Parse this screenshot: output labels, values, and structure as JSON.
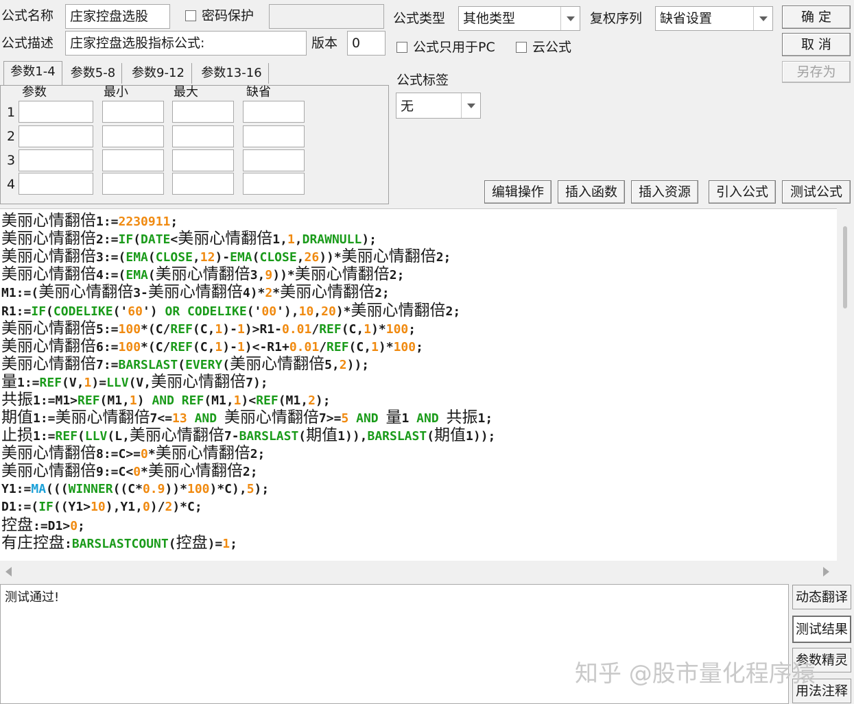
{
  "header": {
    "formula_name_label": "公式名称",
    "formula_name_value": "庄家控盘选股",
    "password_label": "密码保护",
    "password_value": "",
    "formula_desc_label": "公式描述",
    "formula_desc_value": "庄家控盘选股指标公式:",
    "version_label": "版本",
    "version_value": "0",
    "formula_type_label": "公式类型",
    "formula_type_value": "其他类型",
    "fuquan_label": "复权序列",
    "fuquan_value": "缺省设置",
    "pc_only_label": "公式只用于PC",
    "cloud_label": "云公式",
    "tag_label": "公式标签",
    "tag_value": "无"
  },
  "buttons": {
    "ok": "确  定",
    "cancel": "取  消",
    "save_as": "另存为",
    "edit_ops": "编辑操作",
    "insert_func": "插入函数",
    "insert_res": "插入资源",
    "import_formula": "引入公式",
    "test_formula": "测试公式"
  },
  "params": {
    "tabs": [
      "参数1-4",
      "参数5-8",
      "参数9-12",
      "参数13-16"
    ],
    "columns": [
      "参数",
      "最小",
      "最大",
      "缺省"
    ],
    "rows": [
      "1",
      "2",
      "3",
      "4"
    ]
  },
  "code_lines": [
    [
      [
        "cj",
        "美丽心情翻倍"
      ],
      [
        "v",
        "1:="
      ],
      [
        "n",
        "2230911"
      ],
      [
        "v",
        ";"
      ]
    ],
    [
      [
        "cj",
        "美丽心情翻倍"
      ],
      [
        "v",
        "2:="
      ],
      [
        "f",
        "IF"
      ],
      [
        "v",
        "("
      ],
      [
        "f",
        "DATE"
      ],
      [
        "v",
        "<"
      ],
      [
        "cj",
        "美丽心情翻倍"
      ],
      [
        "v",
        "1,"
      ],
      [
        "n",
        "1"
      ],
      [
        "v",
        ","
      ],
      [
        "f",
        "DRAWNULL"
      ],
      [
        "v",
        ");"
      ]
    ],
    [
      [
        "cj",
        "美丽心情翻倍"
      ],
      [
        "v",
        "3:=("
      ],
      [
        "f",
        "EMA"
      ],
      [
        "v",
        "("
      ],
      [
        "f",
        "CLOSE"
      ],
      [
        "v",
        ","
      ],
      [
        "n",
        "12"
      ],
      [
        "v",
        ")-"
      ],
      [
        "f",
        "EMA"
      ],
      [
        "v",
        "("
      ],
      [
        "f",
        "CLOSE"
      ],
      [
        "v",
        ","
      ],
      [
        "n",
        "26"
      ],
      [
        "v",
        "))*"
      ],
      [
        "cj",
        "美丽心情翻倍"
      ],
      [
        "v",
        "2;"
      ]
    ],
    [
      [
        "cj",
        "美丽心情翻倍"
      ],
      [
        "v",
        "4:=("
      ],
      [
        "f",
        "EMA"
      ],
      [
        "v",
        "("
      ],
      [
        "cj",
        "美丽心情翻倍"
      ],
      [
        "v",
        "3,"
      ],
      [
        "n",
        "9"
      ],
      [
        "v",
        "))*"
      ],
      [
        "cj",
        "美丽心情翻倍"
      ],
      [
        "v",
        "2;"
      ]
    ],
    [
      [
        "v",
        "M1:=("
      ],
      [
        "cj",
        "美丽心情翻倍"
      ],
      [
        "v",
        "3-"
      ],
      [
        "cj",
        "美丽心情翻倍"
      ],
      [
        "v",
        "4)*"
      ],
      [
        "n",
        "2"
      ],
      [
        "v",
        "*"
      ],
      [
        "cj",
        "美丽心情翻倍"
      ],
      [
        "v",
        "2;"
      ]
    ],
    [
      [
        "v",
        "R1:="
      ],
      [
        "f",
        "IF"
      ],
      [
        "v",
        "("
      ],
      [
        "f",
        "CODELIKE"
      ],
      [
        "v",
        "('"
      ],
      [
        "n",
        "60"
      ],
      [
        "v",
        "') "
      ],
      [
        "f",
        "OR"
      ],
      [
        "v",
        " "
      ],
      [
        "f",
        "CODELIKE"
      ],
      [
        "v",
        "('"
      ],
      [
        "n",
        "00"
      ],
      [
        "v",
        "'),"
      ],
      [
        "n",
        "10"
      ],
      [
        "v",
        ","
      ],
      [
        "n",
        "20"
      ],
      [
        "v",
        ")*"
      ],
      [
        "cj",
        "美丽心情翻倍"
      ],
      [
        "v",
        "2;"
      ]
    ],
    [
      [
        "cj",
        "美丽心情翻倍"
      ],
      [
        "v",
        "5:="
      ],
      [
        "n",
        "100"
      ],
      [
        "v",
        "*(C/"
      ],
      [
        "f",
        "REF"
      ],
      [
        "v",
        "(C,"
      ],
      [
        "n",
        "1"
      ],
      [
        "v",
        ")-"
      ],
      [
        "n",
        "1"
      ],
      [
        "v",
        ")>R1-"
      ],
      [
        "n",
        "0.01"
      ],
      [
        "v",
        "/"
      ],
      [
        "f",
        "REF"
      ],
      [
        "v",
        "(C,"
      ],
      [
        "n",
        "1"
      ],
      [
        "v",
        ")*"
      ],
      [
        "n",
        "100"
      ],
      [
        "v",
        ";"
      ]
    ],
    [
      [
        "cj",
        "美丽心情翻倍"
      ],
      [
        "v",
        "6:="
      ],
      [
        "n",
        "100"
      ],
      [
        "v",
        "*(C/"
      ],
      [
        "f",
        "REF"
      ],
      [
        "v",
        "(C,"
      ],
      [
        "n",
        "1"
      ],
      [
        "v",
        ")-"
      ],
      [
        "n",
        "1"
      ],
      [
        "v",
        ")<-R1+"
      ],
      [
        "n",
        "0.01"
      ],
      [
        "v",
        "/"
      ],
      [
        "f",
        "REF"
      ],
      [
        "v",
        "(C,"
      ],
      [
        "n",
        "1"
      ],
      [
        "v",
        ")*"
      ],
      [
        "n",
        "100"
      ],
      [
        "v",
        ";"
      ]
    ],
    [
      [
        "cj",
        "美丽心情翻倍"
      ],
      [
        "v",
        "7:="
      ],
      [
        "f",
        "BARSLAST"
      ],
      [
        "v",
        "("
      ],
      [
        "f",
        "EVERY"
      ],
      [
        "v",
        "("
      ],
      [
        "cj",
        "美丽心情翻倍"
      ],
      [
        "v",
        "5,"
      ],
      [
        "n",
        "2"
      ],
      [
        "v",
        "));"
      ]
    ],
    [
      [
        "cj",
        "量"
      ],
      [
        "v",
        "1:="
      ],
      [
        "f",
        "REF"
      ],
      [
        "v",
        "(V,"
      ],
      [
        "n",
        "1"
      ],
      [
        "v",
        ")="
      ],
      [
        "f",
        "LLV"
      ],
      [
        "v",
        "(V,"
      ],
      [
        "cj",
        "美丽心情翻倍"
      ],
      [
        "v",
        "7);"
      ]
    ],
    [
      [
        "cj",
        "共振"
      ],
      [
        "v",
        "1:=M1>"
      ],
      [
        "f",
        "REF"
      ],
      [
        "v",
        "(M1,"
      ],
      [
        "n",
        "1"
      ],
      [
        "v",
        ") "
      ],
      [
        "f",
        "AND"
      ],
      [
        "v",
        " "
      ],
      [
        "f",
        "REF"
      ],
      [
        "v",
        "(M1,"
      ],
      [
        "n",
        "1"
      ],
      [
        "v",
        ")<"
      ],
      [
        "f",
        "REF"
      ],
      [
        "v",
        "(M1,"
      ],
      [
        "n",
        "2"
      ],
      [
        "v",
        ");"
      ]
    ],
    [
      [
        "cj",
        "期值"
      ],
      [
        "v",
        "1:="
      ],
      [
        "cj",
        "美丽心情翻倍"
      ],
      [
        "v",
        "7<="
      ],
      [
        "n",
        "13"
      ],
      [
        "v",
        " "
      ],
      [
        "f",
        "AND"
      ],
      [
        "v",
        " "
      ],
      [
        "cj",
        "美丽心情翻倍"
      ],
      [
        "v",
        "7>="
      ],
      [
        "n",
        "5"
      ],
      [
        "v",
        " "
      ],
      [
        "f",
        "AND"
      ],
      [
        "v",
        " "
      ],
      [
        "cj",
        "量"
      ],
      [
        "v",
        "1 "
      ],
      [
        "f",
        "AND"
      ],
      [
        "v",
        " "
      ],
      [
        "cj",
        "共振"
      ],
      [
        "v",
        "1;"
      ]
    ],
    [
      [
        "cj",
        "止损"
      ],
      [
        "v",
        "1:="
      ],
      [
        "f",
        "REF"
      ],
      [
        "v",
        "("
      ],
      [
        "f",
        "LLV"
      ],
      [
        "v",
        "(L,"
      ],
      [
        "cj",
        "美丽心情翻倍"
      ],
      [
        "v",
        "7-"
      ],
      [
        "f",
        "BARSLAST"
      ],
      [
        "v",
        "("
      ],
      [
        "cj",
        "期值"
      ],
      [
        "v",
        "1)),"
      ],
      [
        "f",
        "BARSLAST"
      ],
      [
        "v",
        "("
      ],
      [
        "cj",
        "期值"
      ],
      [
        "v",
        "1));"
      ]
    ],
    [
      [
        "cj",
        "美丽心情翻倍"
      ],
      [
        "v",
        "8:=C>="
      ],
      [
        "n",
        "0"
      ],
      [
        "v",
        "*"
      ],
      [
        "cj",
        "美丽心情翻倍"
      ],
      [
        "v",
        "2;"
      ]
    ],
    [
      [
        "cj",
        "美丽心情翻倍"
      ],
      [
        "v",
        "9:=C<"
      ],
      [
        "n",
        "0"
      ],
      [
        "v",
        "*"
      ],
      [
        "cj",
        "美丽心情翻倍"
      ],
      [
        "v",
        "2;"
      ]
    ],
    [
      [
        "v",
        "Y1:="
      ],
      [
        "m",
        "MA"
      ],
      [
        "v",
        "((("
      ],
      [
        "f",
        "WINNER"
      ],
      [
        "v",
        "((C*"
      ],
      [
        "n",
        "0.9"
      ],
      [
        "v",
        "))*"
      ],
      [
        "n",
        "100"
      ],
      [
        "v",
        ")*C),"
      ],
      [
        "n",
        "5"
      ],
      [
        "v",
        ");"
      ]
    ],
    [
      [
        "v",
        "D1:=("
      ],
      [
        "f",
        "IF"
      ],
      [
        "v",
        "((Y1>"
      ],
      [
        "n",
        "10"
      ],
      [
        "v",
        "),Y1,"
      ],
      [
        "n",
        "0"
      ],
      [
        "v",
        ")/"
      ],
      [
        "n",
        "2"
      ],
      [
        "v",
        ")*C;"
      ]
    ],
    [
      [
        "cj",
        "控盘"
      ],
      [
        "v",
        ":=D1>"
      ],
      [
        "n",
        "0"
      ],
      [
        "v",
        ";"
      ]
    ],
    [
      [
        "cj",
        "有庄控盘"
      ],
      [
        "v",
        ":"
      ],
      [
        "f",
        "BARSLASTCOUNT"
      ],
      [
        "v",
        "("
      ],
      [
        "cj",
        "控盘"
      ],
      [
        "v",
        ")="
      ],
      [
        "n",
        "1"
      ],
      [
        "v",
        ";"
      ]
    ]
  ],
  "message": "测试通过!",
  "side_buttons": [
    "动态翻译",
    "测试结果",
    "参数精灵",
    "用法注释"
  ],
  "watermark": "知乎 @股市量化程序猿"
}
